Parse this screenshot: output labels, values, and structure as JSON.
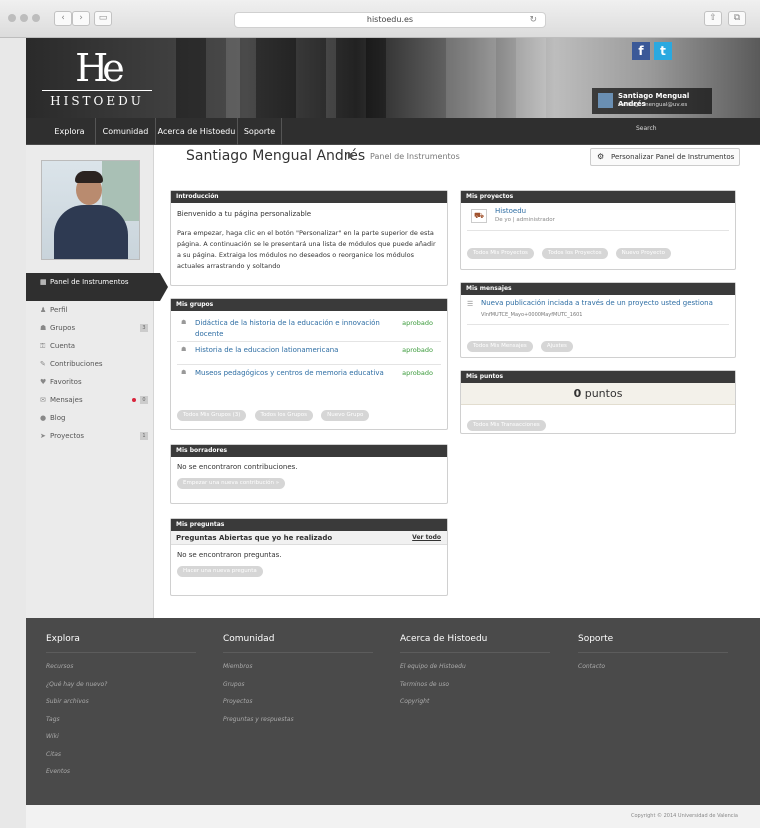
{
  "browser": {
    "url": "histoedu.es"
  },
  "site": {
    "logo_mark": "He",
    "logo_text": "HISTOEDU",
    "social": {
      "facebook": "f",
      "twitter": "t"
    },
    "user_name": "Santiago Mengual Andrés",
    "user_email": "santiago.mengual@uv.es"
  },
  "nav": {
    "items": [
      "Explora",
      "Comunidad",
      "Acerca de Histoedu",
      "Soporte"
    ],
    "search": "Search"
  },
  "sidebar": {
    "items": [
      {
        "label": "Panel de Instrumentos",
        "icon": "grid-icon"
      },
      {
        "label": "Perfil",
        "icon": "user-icon"
      },
      {
        "label": "Grupos",
        "icon": "group-icon",
        "count": "3"
      },
      {
        "label": "Cuenta",
        "icon": "key-icon"
      },
      {
        "label": "Contribuciones",
        "icon": "pencil-icon"
      },
      {
        "label": "Favoritos",
        "icon": "heart-icon"
      },
      {
        "label": "Mensajes",
        "icon": "mail-icon",
        "count": "0"
      },
      {
        "label": "Blog",
        "icon": "chat-icon"
      },
      {
        "label": "Proyectos",
        "icon": "send-icon",
        "count": "1"
      }
    ]
  },
  "header": {
    "name": "Santiago Mengual Andrés",
    "arrow": "▶",
    "crumb": "Panel de Instrumentos",
    "customize": "Personalizar Panel de Instrumentos"
  },
  "intro": {
    "title": "Introducción",
    "p1": "Bienvenido a tu página personalizable",
    "p2": "Para empezar, haga clic en el botón \"Personalizar\" en la parte superior de esta página. A continuación se le presentará una lista de módulos que puede añadir a su página. Extraiga los módulos no deseados o reorganice los módulos actuales arrastrando y soltando"
  },
  "groups": {
    "title": "Mis grupos",
    "rows": [
      {
        "name": "Didáctica de la historia de la educación e innovación docente",
        "status": "aprobado"
      },
      {
        "name": "Historia de la educacion lationamericana",
        "status": "aprobado"
      },
      {
        "name": "Museos pedagógicos y centros de memoria educativa",
        "status": "aprobado"
      }
    ],
    "buttons": [
      "Todos Mis Grupos (3)",
      "Todos los Grupos",
      "Nuevo Grupo"
    ]
  },
  "drafts": {
    "title": "Mis borradores",
    "empty": "No se encontraron contribuciones.",
    "button": "Empezar una nueva contribución »"
  },
  "questions": {
    "title": "Mis preguntas",
    "subtitle": "Preguntas Abiertas que yo he realizado",
    "view_all": "Ver todo",
    "empty": "No se encontraron preguntas.",
    "button": "Hacer una nueva pregunta"
  },
  "projects": {
    "title": "Mis proyectos",
    "name": "Histoedu",
    "meta": "De yo | administrador",
    "buttons": [
      "Todos Mis Proyectos",
      "Todos los Proyectos",
      "Nuevo Proyecto"
    ]
  },
  "messages": {
    "title": "Mis mensajes",
    "subject": "Nueva publicación inciada a través de un proyecto usted gestiona",
    "meta": "VlnfMUTCE_Mayo+0000MayfMUTC_1601",
    "buttons": [
      "Todos Mis Mensajes",
      "Ajustes"
    ]
  },
  "points": {
    "title": "Mis puntos",
    "value": "0",
    "unit": "puntos",
    "button": "Todos Mis Transacciones"
  },
  "footer": {
    "columns": [
      {
        "title": "Explora",
        "links": [
          "Recursos",
          "¿Qué hay de nuevo?",
          "Subir archivos",
          "Tags",
          "Wiki",
          "Citas",
          "Eventos"
        ]
      },
      {
        "title": "Comunidad",
        "links": [
          "Miembros",
          "Grupos",
          "Proyectos",
          "Preguntas y respuestas"
        ]
      },
      {
        "title": "Acerca de Histoedu",
        "links": [
          "El equipo de Histoedu",
          "Terminos de uso",
          "Copyright"
        ]
      },
      {
        "title": "Soporte",
        "links": [
          "Contacto"
        ]
      }
    ],
    "copyright": "Copyright © 2014 Universidad de Valencia"
  },
  "colors": {
    "accent": "#2d6da3",
    "dark": "#2f2f2f",
    "approved": "#3a9a3a"
  }
}
